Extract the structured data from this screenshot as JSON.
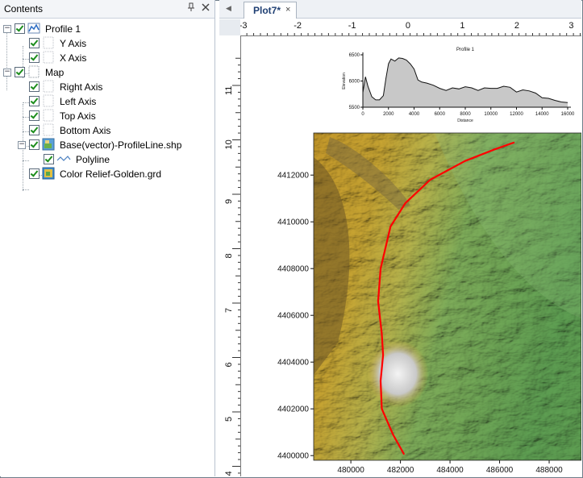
{
  "contents_panel": {
    "title": "Contents",
    "pin_icon": "pin-icon",
    "close_icon": "close-icon",
    "tree": [
      {
        "label": "Profile 1",
        "depth": 0,
        "expander": "−",
        "checked": true,
        "icon": "profile-chart-icon"
      },
      {
        "label": "Y Axis",
        "depth": 1,
        "checked": true,
        "icon": "axis-icon"
      },
      {
        "label": "X Axis",
        "depth": 1,
        "checked": true,
        "icon": "axis-icon"
      },
      {
        "label": "Map",
        "depth": 0,
        "expander": "−",
        "checked": true,
        "icon": "map-frame-icon"
      },
      {
        "label": "Right Axis",
        "depth": 1,
        "checked": true,
        "icon": "axis-icon"
      },
      {
        "label": "Left Axis",
        "depth": 1,
        "checked": true,
        "icon": "axis-icon"
      },
      {
        "label": "Top Axis",
        "depth": 1,
        "checked": true,
        "icon": "axis-icon"
      },
      {
        "label": "Bottom Axis",
        "depth": 1,
        "checked": true,
        "icon": "axis-icon"
      },
      {
        "label": "Base(vector)-ProfileLine.shp",
        "depth": 1,
        "expander": "−",
        "checked": true,
        "icon": "base-layer-icon"
      },
      {
        "label": "Polyline",
        "depth": 2,
        "checked": true,
        "icon": "polyline-icon"
      },
      {
        "label": "Color Relief-Golden.grd",
        "depth": 1,
        "checked": true,
        "icon": "color-relief-icon"
      }
    ]
  },
  "document": {
    "tab_label": "Plot7*",
    "tab_close": "×",
    "tab_scroll_icon": "◀",
    "ruler_h_labels": [
      "-3",
      "-2",
      "-1",
      "0",
      "1",
      "2",
      "3"
    ],
    "ruler_v_labels": [
      "11",
      "10",
      "9",
      "8",
      "7",
      "6",
      "5",
      "4"
    ]
  },
  "chart_data": [
    {
      "type": "area",
      "title": "Profile 1",
      "xlabel": "Distance",
      "ylabel": "Elevation",
      "xlim": [
        0,
        16000
      ],
      "ylim": [
        5500,
        6500
      ],
      "xticks": [
        0,
        2000,
        4000,
        6000,
        8000,
        10000,
        12000,
        14000,
        16000
      ],
      "yticks": [
        5500,
        6000,
        6500
      ],
      "fill_color": "#c8c8c8",
      "x": [
        0,
        200,
        400,
        700,
        1000,
        1300,
        1600,
        1800,
        2000,
        2200,
        2500,
        2800,
        3100,
        3400,
        3700,
        4000,
        4300,
        4600,
        5000,
        5500,
        6000,
        6500,
        7000,
        7500,
        8000,
        8500,
        9000,
        9500,
        10000,
        10500,
        11000,
        11500,
        12000,
        12500,
        13000,
        13500,
        14000,
        14500,
        15000,
        15500,
        16000
      ],
      "y": [
        5780,
        6080,
        5900,
        5700,
        5640,
        5640,
        5720,
        6050,
        6330,
        6420,
        6380,
        6440,
        6430,
        6400,
        6330,
        6230,
        6020,
        5980,
        5960,
        5920,
        5860,
        5820,
        5870,
        5850,
        5890,
        5870,
        5820,
        5870,
        5860,
        5860,
        5900,
        5880,
        5790,
        5830,
        5810,
        5770,
        5680,
        5670,
        5630,
        5600,
        5590
      ]
    },
    {
      "type": "map",
      "title": "",
      "xlim": [
        478500,
        489300
      ],
      "ylim": [
        4399800,
        4413800
      ],
      "xticks": [
        480000,
        482000,
        484000,
        486000,
        488000
      ],
      "yticks": [
        4400000,
        4402000,
        4404000,
        4406000,
        4408000,
        4410000,
        4412000
      ],
      "line_color": "#ff0000",
      "profile_line": {
        "x": [
          482150,
          481700,
          481250,
          481200,
          481300,
          481250,
          481100,
          481200,
          481600,
          482200,
          483200,
          484600,
          485800,
          486600
        ],
        "y": [
          4400050,
          4400900,
          4402000,
          4403200,
          4404300,
          4405200,
          4406600,
          4408000,
          4409800,
          4410800,
          4411800,
          4412600,
          4413100,
          4413400
        ]
      }
    }
  ]
}
